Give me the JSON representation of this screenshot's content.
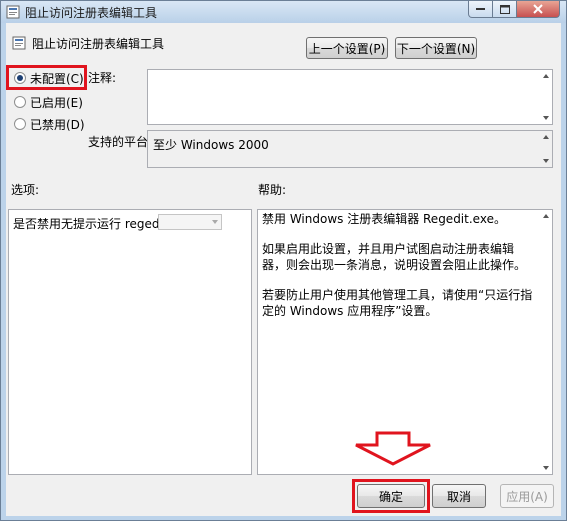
{
  "window": {
    "title": "阻止访问注册表编辑工具"
  },
  "header": {
    "policy_name": "阻止访问注册表编辑工具",
    "prev_button": "上一个设置(P)",
    "next_button": "下一个设置(N)"
  },
  "state": {
    "not_configured": "未配置(C)",
    "enabled": "已启用(E)",
    "disabled": "已禁用(D)",
    "selected": "not_configured"
  },
  "comment": {
    "label": "注释:",
    "value": ""
  },
  "platform": {
    "label": "支持的平台:",
    "value": "至少 Windows 2000"
  },
  "options": {
    "label": "选项:",
    "question": "是否禁用无提示运行 regedit？",
    "dropdown_value": ""
  },
  "help": {
    "label": "帮助:",
    "paragraphs": [
      "禁用 Windows 注册表编辑器 Regedit.exe。",
      "如果启用此设置，并且用户试图启动注册表编辑器，则会出现一条消息，说明设置会阻止此操作。",
      "若要防止用户使用其他管理工具，请使用“只运行指定的 Windows 应用程序”设置。"
    ]
  },
  "footer": {
    "ok": "确定",
    "cancel": "取消",
    "apply": "应用(A)"
  },
  "colors": {
    "highlight_red": "#e0141e",
    "arrow_red": "#e0141e"
  }
}
